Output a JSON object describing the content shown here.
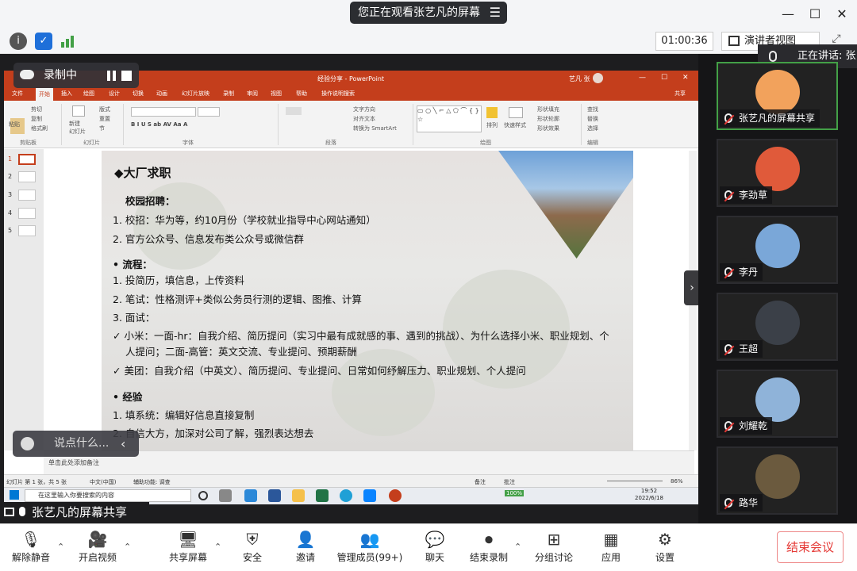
{
  "window": {
    "viewing_text": "您正在观看张艺凡的屏幕",
    "menu_glyph": "☰",
    "minimize": "—",
    "maximize": "☐",
    "close": "✕"
  },
  "toolbar": {
    "timer": "01:00:36",
    "speaker_view": "演讲者视图",
    "speaking_now": "正在讲话: 张"
  },
  "recording": {
    "label": "录制中"
  },
  "ppt": {
    "title": "经验分享 - PowerPoint",
    "user": "艺凡 张",
    "share": "共享",
    "tabs": [
      "文件",
      "开始",
      "插入",
      "绘图",
      "设计",
      "切换",
      "动画",
      "幻灯片放映",
      "录制",
      "审阅",
      "视图",
      "帮助",
      "操作说明搜索"
    ],
    "ribbon_groups": [
      "剪贴板",
      "幻灯片",
      "字体",
      "段落",
      "绘图",
      "编辑"
    ],
    "ribbon_items": {
      "paste": "粘贴",
      "cut": "剪切",
      "copy": "复制",
      "format_painter": "格式刷",
      "new_slide": "新建\n幻灯片",
      "layout": "版式",
      "reset": "重置",
      "section": "节",
      "text_direction": "文字方向",
      "align_text": "对齐文本",
      "smartart": "转换为 SmartArt",
      "arrange": "排列",
      "quick_styles": "快速样式",
      "shape_fill": "形状填充",
      "shape_outline": "形状轮廓",
      "shape_effects": "形状效果",
      "find": "查找",
      "replace": "替换",
      "select": "选择"
    },
    "thumbnail_numbers": [
      "1",
      "2",
      "3",
      "4",
      "5"
    ],
    "notes_placeholder": "单击此处添加备注",
    "status_left": "幻灯片 第 1 张，共 5 张",
    "status_lang": "中文(中国)",
    "status_access": "辅助功能: 调查",
    "status_notes": "备注",
    "status_comments": "批注",
    "zoom": "86%"
  },
  "slide": {
    "title": "◆大厂求职",
    "lines": [
      {
        "text": "校园招聘：",
        "bold": true
      },
      {
        "text": "1.  校招：华为等，约10月份（学校就业指导中心网站通知）",
        "bold": false
      },
      {
        "text": "2.  官方公众号、信息发布类公众号或微信群",
        "bold": false
      },
      {
        "text": "•   流程：",
        "bold": true
      },
      {
        "text": "1.  投简历，填信息，上传资料",
        "bold": false
      },
      {
        "text": "2.  笔试：性格测评+类似公务员行测的逻辑、图推、计算",
        "bold": false
      },
      {
        "text": "3.  面试：",
        "bold": false
      },
      {
        "text": "✓ 小米：一面-hr：自我介绍、简历提问（实习中最有成就感的事、遇到的挑战）、为什么选择小米、职业规划、个",
        "bold": false
      },
      {
        "text": "人提问；二面-高管：英文交流、专业提问、预期薪酬",
        "bold": false
      },
      {
        "text": "✓ 美团：自我介绍（中英文）、简历提问、专业提问、日常如何纾解压力、职业规划、个人提问",
        "bold": false
      },
      {
        "text": "•   经验",
        "bold": true
      },
      {
        "text": "1.  填系统：编辑好信息直接复制",
        "bold": false
      },
      {
        "text": "2.  自信大方，加深对公司了解，强烈表达想去",
        "bold": false
      }
    ]
  },
  "taskbar": {
    "search_placeholder": "在这里输入你要搜索的内容",
    "battery": "100%",
    "time": "19:52",
    "date": "2022/6/18"
  },
  "chat": {
    "placeholder": "说点什么..."
  },
  "share_label": "张艺凡的屏幕共享",
  "participants": [
    {
      "name": "张艺凡的屏幕共享",
      "color": "#f2a25c"
    },
    {
      "name": "李劲草",
      "color": "#e05a3a"
    },
    {
      "name": "李丹",
      "color": "#7aa7d8"
    },
    {
      "name": "王超",
      "color": "#3b4048"
    },
    {
      "name": "刘耀乾",
      "color": "#8fb3d9"
    },
    {
      "name": "路华",
      "color": "#6b5a3e"
    }
  ],
  "bottom": {
    "mute": "解除静音",
    "video": "开启视频",
    "share": "共享屏幕",
    "security": "安全",
    "invite": "邀请",
    "participants": "管理成员(99+)",
    "chat": "聊天",
    "end_record": "结束录制",
    "breakout": "分组讨论",
    "apps": "应用",
    "settings": "设置",
    "end_meeting": "结束会议"
  }
}
